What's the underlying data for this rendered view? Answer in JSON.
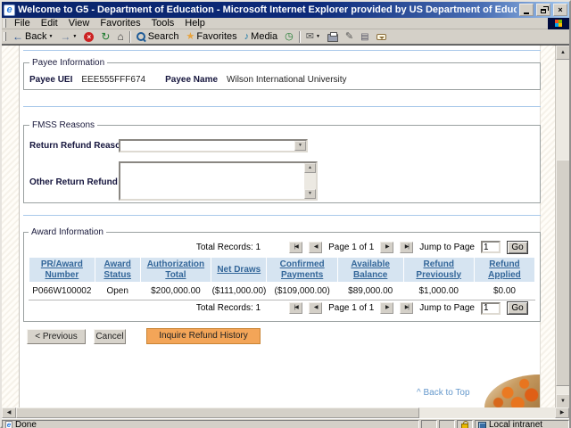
{
  "window": {
    "title": "Welcome to G5 - Department of Education - Microsoft Internet Explorer provided by US Department of Education",
    "menu": [
      "File",
      "Edit",
      "View",
      "Favorites",
      "Tools",
      "Help"
    ],
    "toolbar": {
      "back": "Back",
      "search": "Search",
      "favorites": "Favorites",
      "media": "Media"
    },
    "statusbar": {
      "message": "Done",
      "zone": "Local intranet"
    }
  },
  "icons": {
    "close": "×",
    "back_arrow": "←",
    "forward_arrow": "→",
    "stop": "×",
    "refresh": "↻",
    "home": "⌂",
    "favorites_star": "★",
    "media_note": "♪",
    "history_clock": "◷",
    "mail_envelope": "✉",
    "edit_pencil": "✎",
    "page_glyph": "▤",
    "dropdown_arrow": "▼",
    "scroll_up": "▲",
    "scroll_down": "▼",
    "scroll_left": "◀",
    "scroll_right": "▶",
    "first_page": "|◀",
    "prev_page": "◀",
    "next_page": "▶",
    "last_page": "▶|",
    "back_to_top_caret": "^"
  },
  "page": {
    "payee": {
      "legend": "Payee Information",
      "uei_label": "Payee UEI",
      "uei_value": "EEE555FFF674",
      "name_label": "Payee Name",
      "name_value": "Wilson International University"
    },
    "fmss": {
      "legend": "FMSS Reasons",
      "return_label": "Return Refund Reason",
      "return_value": "",
      "other_label": "Other Return Refund Reason",
      "other_value": ""
    },
    "award": {
      "legend": "Award Information",
      "pagination": {
        "total": "Total Records: 1",
        "page": "Page 1 of 1",
        "jump_label": "Jump to Page",
        "jump_value": "1",
        "go": "Go"
      },
      "table": {
        "headers": [
          "PR/Award Number",
          "Award Status",
          "Authorization Total",
          "Net Draws",
          "Confirmed Payments",
          "Available Balance",
          "Refund Previously",
          "Refund Applied"
        ],
        "rows": [
          [
            "P066W100002",
            "Open",
            "$200,000.00",
            "($111,000.00)",
            "($109,000.00)",
            "$89,000.00",
            "$1,000.00",
            "$0.00"
          ]
        ]
      }
    },
    "buttons": {
      "previous": "< Previous",
      "cancel": "Cancel",
      "inquire": "Inquire Refund History"
    },
    "back_to_top": "^ Back to Top"
  },
  "colors": {
    "titlebar_navy": "#0a246a",
    "titlebar_light": "#a6caf0",
    "chrome_gray": "#d4d0c8",
    "table_header_bg": "#d6e4f1",
    "link_blue": "#336699",
    "negative_red": "#cc0000",
    "divider_blue": "#a9c9ea",
    "inquire_orange": "#f3a558",
    "back_to_top_blue": "#6699cc"
  }
}
